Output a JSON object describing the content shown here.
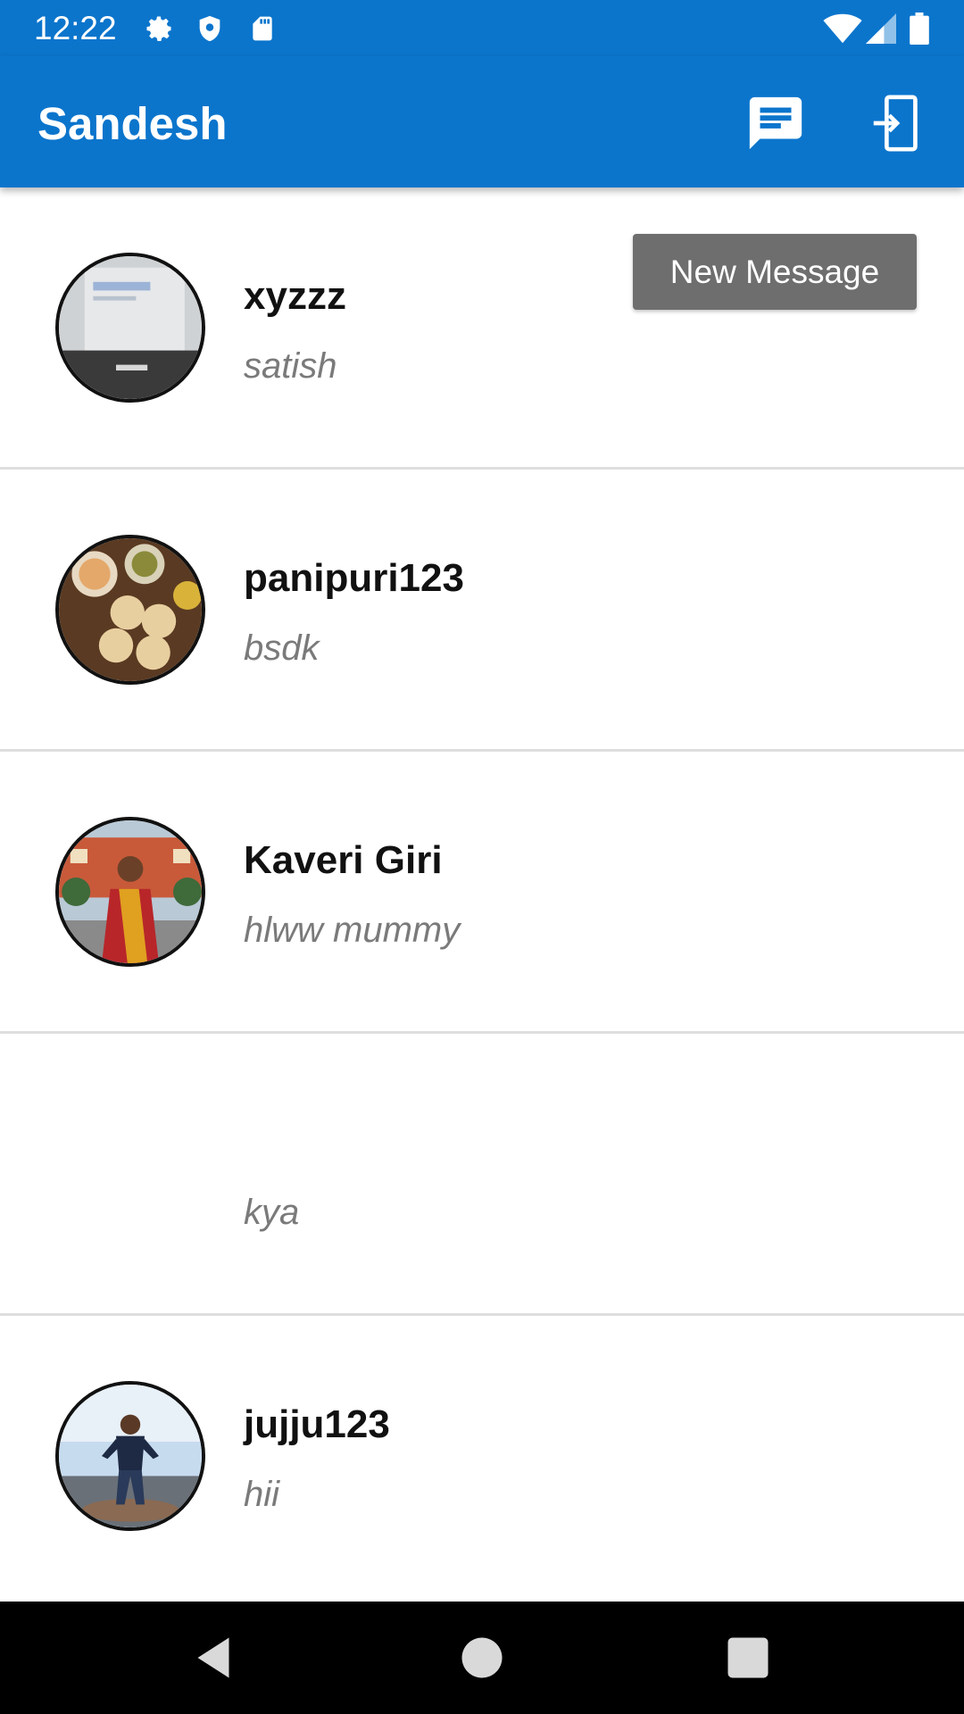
{
  "status_bar": {
    "time": "12:22",
    "icons": [
      "gear-icon",
      "shield-icon",
      "sd-card-icon",
      "wifi-icon",
      "signal-icon",
      "battery-icon"
    ]
  },
  "app_bar": {
    "title": "Sandesh",
    "actions": [
      "chat-icon",
      "login-icon"
    ],
    "color": "#0b75cc"
  },
  "chats": [
    {
      "name": "xyzzz",
      "message": "satish",
      "avatar": "photo"
    },
    {
      "name": "panipuri123",
      "message": "bsdk",
      "avatar": "photo"
    },
    {
      "name": "Kaveri Giri",
      "message": "hlww mummy",
      "avatar": "photo"
    },
    {
      "name": "",
      "message": "kya",
      "avatar": "none"
    },
    {
      "name": "jujju123",
      "message": "hii",
      "avatar": "photo"
    }
  ],
  "new_message_button": "New Message",
  "nav_bar": [
    "back-icon",
    "home-icon",
    "recents-icon"
  ]
}
